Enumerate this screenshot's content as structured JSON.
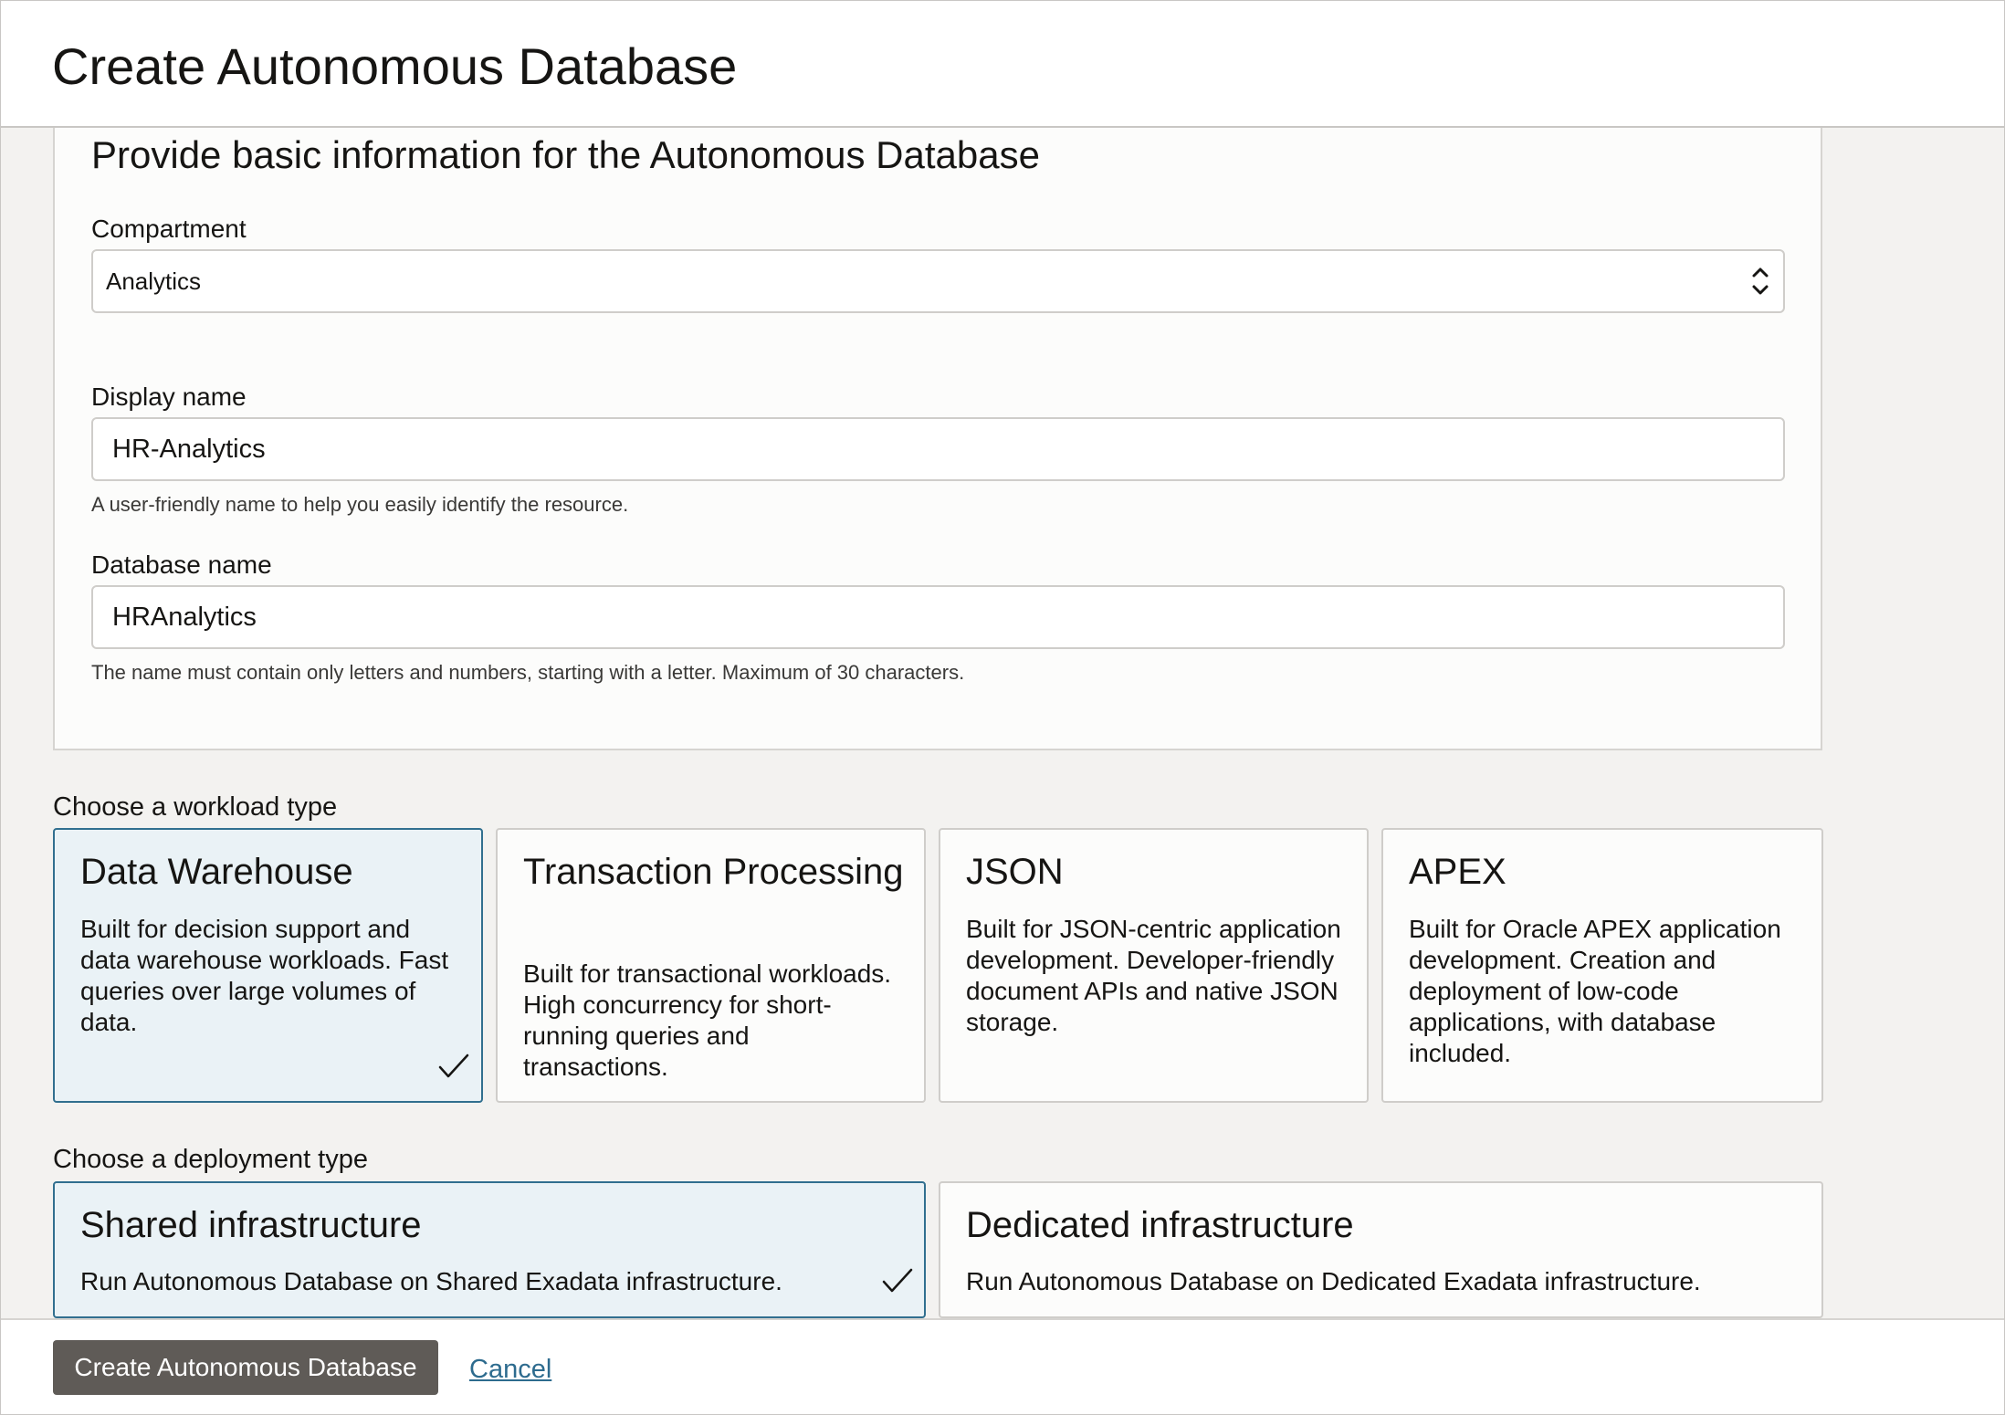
{
  "header": {
    "title": "Create Autonomous Database"
  },
  "basic_info": {
    "heading": "Provide basic information for the Autonomous Database",
    "compartment": {
      "label": "Compartment",
      "value": "Analytics"
    },
    "display_name": {
      "label": "Display name",
      "value": "HR-Analytics",
      "hint": "A user-friendly name to help you easily identify the resource."
    },
    "database_name": {
      "label": "Database name",
      "value": "HRAnalytics",
      "hint": "The name must contain only letters and numbers, starting with a letter. Maximum of 30 characters."
    }
  },
  "workload": {
    "label": "Choose a workload type",
    "options": [
      {
        "title": "Data Warehouse",
        "description": "Built for decision support and data warehouse workloads. Fast queries over large volumes of data.",
        "selected": true
      },
      {
        "title": "Transaction Processing",
        "description": "Built for transactional workloads. High concurrency for short-running queries and transactions.",
        "selected": false
      },
      {
        "title": "JSON",
        "description": "Built for JSON-centric application development. Developer-friendly document APIs and native JSON storage.",
        "selected": false
      },
      {
        "title": "APEX",
        "description": "Built for Oracle APEX application development. Creation and deployment of low-code applications, with database included.",
        "selected": false
      }
    ]
  },
  "deployment": {
    "label": "Choose a deployment type",
    "options": [
      {
        "title": "Shared infrastructure",
        "description": "Run Autonomous Database on Shared Exadata infrastructure.",
        "selected": true
      },
      {
        "title": "Dedicated infrastructure",
        "description": "Run Autonomous Database on Dedicated Exadata infrastructure.",
        "selected": false
      }
    ]
  },
  "footer": {
    "create_label": "Create Autonomous Database",
    "cancel_label": "Cancel"
  },
  "colors": {
    "selected_border": "#316f8f",
    "selected_background": "#eaf2f6",
    "primary_button": "#5f5b57",
    "link": "#2d6b8e"
  },
  "icons": {
    "selected_indicator": "check-icon",
    "select_arrows": "chevron-up-down-icon"
  }
}
